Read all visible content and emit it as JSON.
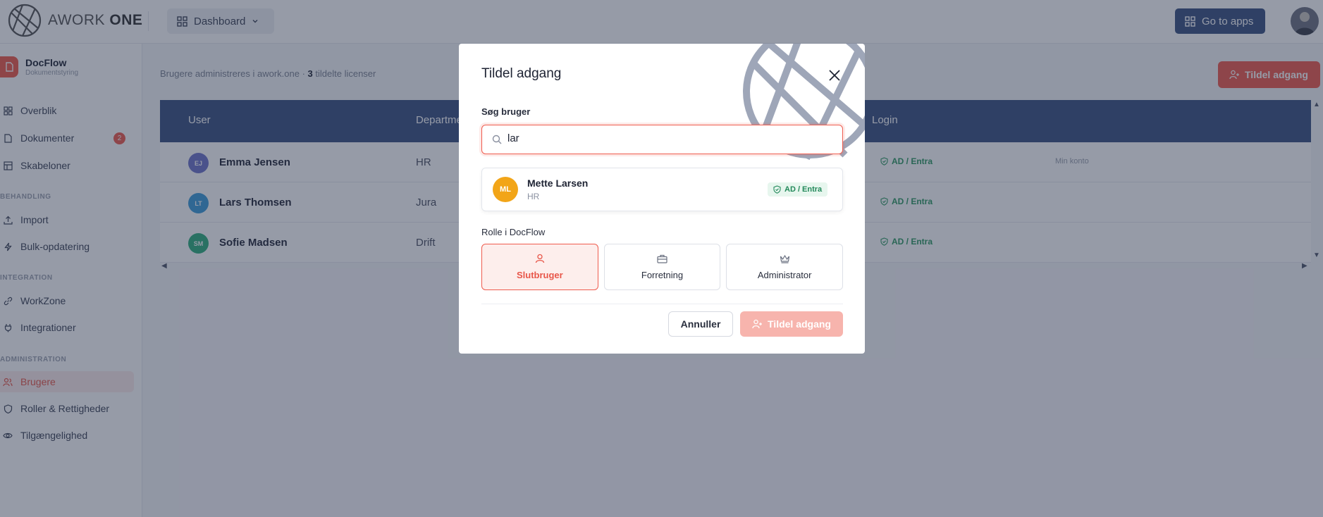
{
  "topbar": {
    "logo_text": "AWORK",
    "logo_bold": "ONE",
    "dashboard_label": "Dashboard",
    "goapps_label": "Go to apps"
  },
  "sidebar": {
    "app_name": "DocFlow",
    "app_sub": "Dokumentstyring",
    "items": [
      {
        "label": "Overblik",
        "icon": "grid-icon"
      },
      {
        "label": "Dokumenter",
        "icon": "file-icon",
        "badge": "2"
      },
      {
        "label": "Skabeloner",
        "icon": "template-icon"
      },
      {
        "label": "Import",
        "icon": "upload-icon"
      },
      {
        "label": "Bulk-opdatering",
        "icon": "bolt-icon"
      },
      {
        "label": "WorkZone",
        "icon": "link-icon"
      },
      {
        "label": "Integrationer",
        "icon": "plug-icon"
      },
      {
        "label": "Brugere",
        "icon": "users-icon",
        "active": true
      },
      {
        "label": "Roller & Rettigheder",
        "icon": "shield-icon"
      },
      {
        "label": "Tilgængelighed",
        "icon": "eye-icon"
      }
    ],
    "sections": [
      "BEHANDLING",
      "INTEGRATION",
      "ADMINISTRATION"
    ]
  },
  "main": {
    "subtitle_prefix": "Brugere administreres i awork.one · ",
    "licenses_count": "3",
    "subtitle_suffix": " tildelte licenser",
    "assign_button": "Tildel adgang",
    "columns": [
      "User",
      "Department",
      "Login"
    ],
    "rows": [
      {
        "initials": "EJ",
        "name": "Emma Jensen",
        "dept": "HR",
        "login": "AD / Entra",
        "note": "Min konto",
        "color": "#6d74c9"
      },
      {
        "initials": "LT",
        "name": "Lars Thomsen",
        "dept": "Jura",
        "login": "AD / Entra",
        "note": "",
        "color": "#3d9bd9"
      },
      {
        "initials": "SM",
        "name": "Sofie Madsen",
        "dept": "Drift",
        "login": "AD / Entra",
        "note": "",
        "color": "#2fae7e"
      }
    ]
  },
  "modal": {
    "title": "Tildel adgang",
    "search_label": "Søg bruger",
    "search_value": "lar",
    "result": {
      "initials": "ML",
      "name": "Mette Larsen",
      "dept": "HR",
      "badge": "AD / Entra"
    },
    "role_label": "Rolle i DocFlow",
    "roles": [
      {
        "label": "Slutbruger",
        "icon": "user-icon",
        "selected": true
      },
      {
        "label": "Forretning",
        "icon": "briefcase-icon",
        "selected": false
      },
      {
        "label": "Administrator",
        "icon": "crown-icon",
        "selected": false
      }
    ],
    "cancel_label": "Annuller",
    "assign_label": "Tildel adgang"
  },
  "colors": {
    "accent": "#ef5b4d",
    "navy": "#3b5281",
    "success": "#2e9a63"
  }
}
